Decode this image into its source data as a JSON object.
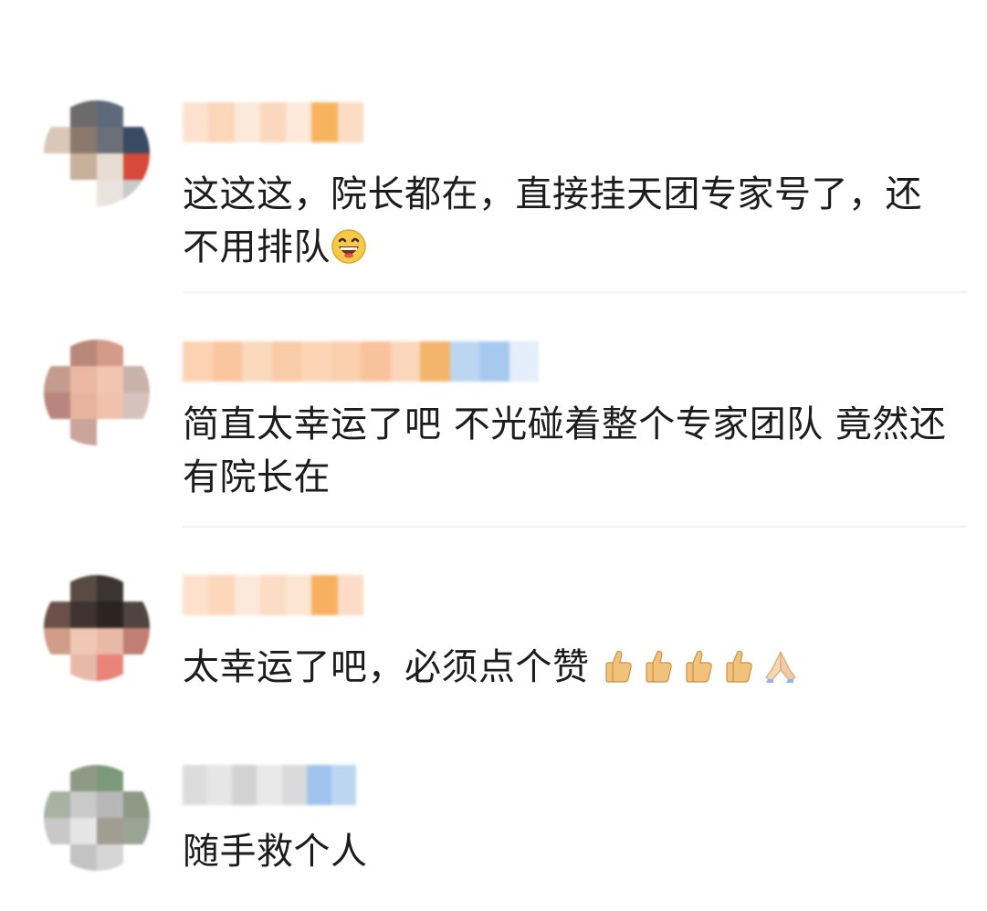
{
  "comments": [
    {
      "text": "这这这，院长都在，直接挂天团专家号了，还不用排队",
      "emoji": "grinning-face-emoji",
      "name_colors": [
        "#fde2cf",
        "#fcd6b8",
        "#fbe9dc",
        "#fbd7bd",
        "#fde8da",
        "#f7b35e",
        "#fcdcc4"
      ],
      "avatar_colors": [
        "#fff",
        "#6b6b6b",
        "#5c6a7a",
        "#fff",
        "#d9c8b7",
        "#8a7a6e",
        "#6a6f7a",
        "#3a4a63",
        "#fff",
        "#c7b19b",
        "#e8ddd2",
        "#d54a3a",
        "#fff",
        "#fff",
        "#e9e3dd",
        "#c9c9c9"
      ]
    },
    {
      "text": "简直太幸运了吧 不光碰着整个专家团队 竟然还有院长在",
      "name_colors": [
        "#fbd3b3",
        "#f9c6a0",
        "#fad9bd",
        "#f9cba6",
        "#fbd5b6",
        "#fad0af",
        "#f8c39c",
        "#fad6bb",
        "#f4b46a",
        "#bcd6f2",
        "#a8c9ef",
        "#e3eefa"
      ],
      "avatar_colors": [
        "#fff",
        "#b9887a",
        "#d49a8a",
        "#fff",
        "#c39c8d",
        "#eab8a3",
        "#f1c5af",
        "#c8b2aa",
        "#b9857f",
        "#e7b39e",
        "#f0c1ab",
        "#d6c2bc",
        "#fff",
        "#c9a49a",
        "#fff",
        "#fff"
      ]
    },
    {
      "text": "太幸运了吧，必须点个赞",
      "emoji": "thumbs-up-emoji",
      "name_colors": [
        "#fde1cc",
        "#fcd7bb",
        "#fde9dc",
        "#fcdcc4",
        "#fde5d3",
        "#f7b060",
        "#fcdcc6"
      ],
      "avatar_colors": [
        "#fff",
        "#5a4a44",
        "#3b3431",
        "#fff",
        "#6a5048",
        "#3e3330",
        "#2a2523",
        "#4f4441",
        "#cf9d88",
        "#f0c7b4",
        "#e8b9a6",
        "#c17e72",
        "#fff",
        "#e8b9a9",
        "#e8847a",
        "#fff"
      ]
    },
    {
      "text": "随手救个人",
      "name_colors": [
        "#dcdcdc",
        "#e6e6e6",
        "#d2d2d2",
        "#e9e9e9",
        "#dadada",
        "#9fc3ed",
        "#bcd6f2"
      ],
      "avatar_colors": [
        "#fff",
        "#8e9a86",
        "#7b9a7a",
        "#fff",
        "#a8b2a2",
        "#c9c9c9",
        "#b7b7b7",
        "#8d9985",
        "#c8c8c8",
        "#e5e5e5",
        "#a09d93",
        "#9aa494",
        "#fff",
        "#c3c3c3",
        "#d6d6d6",
        "#fff"
      ]
    }
  ]
}
